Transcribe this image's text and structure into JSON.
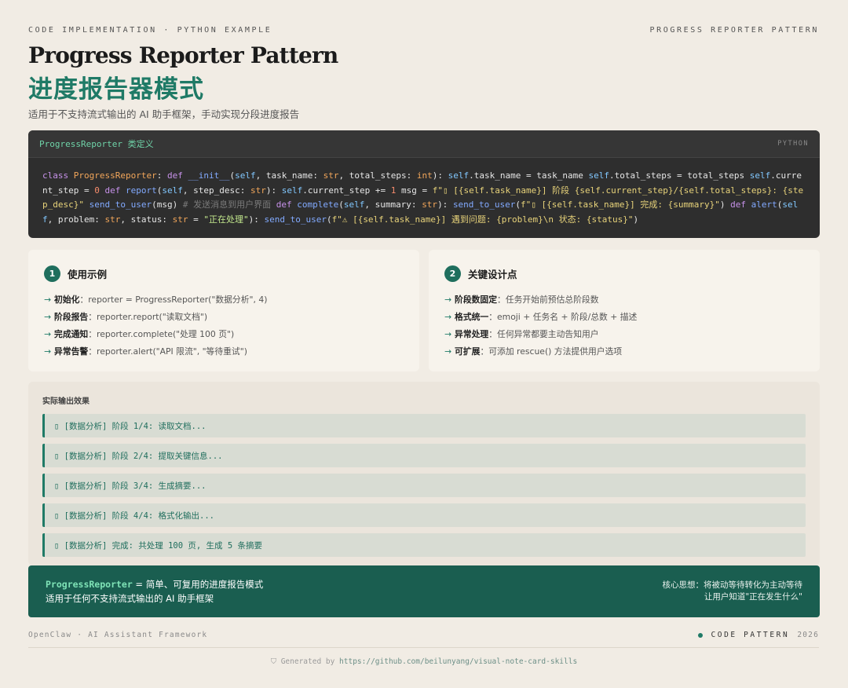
{
  "header": {
    "kicker": "CODE IMPLEMENTATION · PYTHON EXAMPLE",
    "tag": "PROGRESS REPORTER PATTERN",
    "title_en": "Progress Reporter Pattern",
    "title_zh": "进度报告器模式",
    "subtitle": "适用于不支持流式输出的 AI 助手框架，手动实现分段进度报告"
  },
  "code": {
    "class_label": "ProgressReporter 类定义",
    "lang": "PYTHON"
  },
  "usage": {
    "num": "1",
    "title": "使用示例",
    "items": [
      {
        "label": "初始化",
        "text": "：reporter = ProgressReporter(\"数据分析\", 4)"
      },
      {
        "label": "阶段报告",
        "text": "：reporter.report(\"读取文档\")"
      },
      {
        "label": "完成通知",
        "text": "：reporter.complete(\"处理 100 页\")"
      },
      {
        "label": "异常告警",
        "text": "：reporter.alert(\"API 限流\", \"等待重试\")"
      }
    ]
  },
  "design": {
    "num": "2",
    "title": "关键设计点",
    "items": [
      {
        "label": "阶段数固定",
        "text": "：任务开始前预估总阶段数"
      },
      {
        "label": "格式统一",
        "text": "：emoji + 任务名 + 阶段/总数 + 描述"
      },
      {
        "label": "异常处理",
        "text": "：任何异常都要主动告知用户"
      },
      {
        "label": "可扩展",
        "text": "：可添加 rescue() 方法提供用户选项"
      }
    ]
  },
  "output": {
    "title": "实际输出效果",
    "lines": [
      "▯ [数据分析] 阶段 1/4: 读取文档...",
      "▯ [数据分析] 阶段 2/4: 提取关键信息...",
      "▯ [数据分析] 阶段 3/4: 生成摘要...",
      "▯ [数据分析] 阶段 4/4: 格式化输出...",
      "▯ [数据分析] 完成: 共处理 100 页, 生成 5 条摘要"
    ]
  },
  "summary": {
    "cls": "ProgressReporter",
    "line1_rest": " = 简单、可复用的进度报告模式",
    "line2": "适用于任何不支持流式输出的 AI 助手框架",
    "right_line1": "核心思想：将被动等待转化为主动等待",
    "right_line2": "让用户知道\"正在发生什么\""
  },
  "footer": {
    "left": "OpenClaw · AI Assistant Framework",
    "pattern": "CODE PATTERN",
    "year": "2026",
    "gen_prefix": "Generated by ",
    "gen_url": "https://github.com/beilunyang/visual-note-card-skills"
  }
}
